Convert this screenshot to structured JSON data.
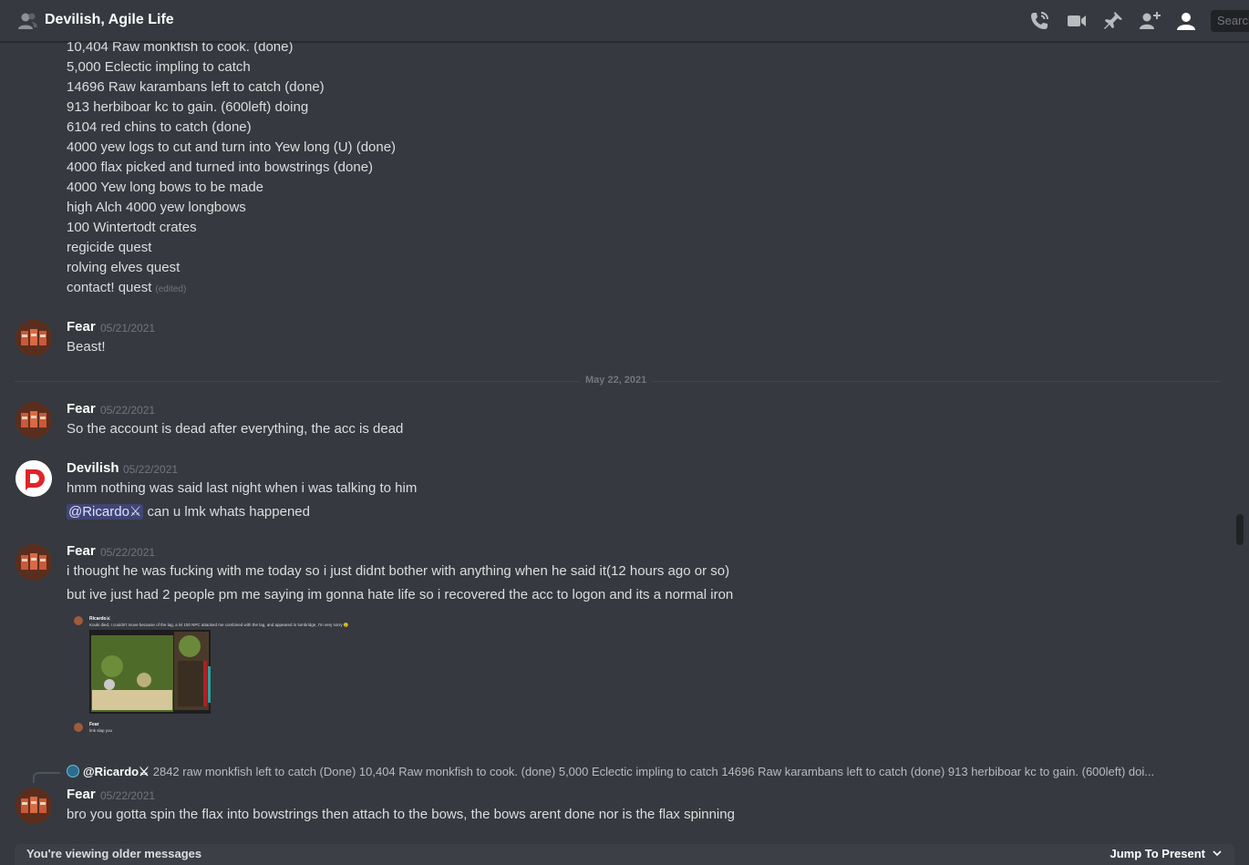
{
  "header": {
    "title": "Devilish, Agile Life",
    "search_placeholder": "Search"
  },
  "continued_lines": [
    "10,404 Raw monkfish to cook.  (done)",
    "5,000 Eclectic impling to catch",
    "14696 Raw karambans left to catch (done)",
    "913 herbiboar kc to gain.   (600left) doing",
    "6104 red chins to catch (done)",
    "4000 yew logs to cut and turn into Yew long (U) (done)",
    "4000 flax picked and turned into bowstrings (done)",
    "4000 Yew long bows to be made",
    "high Alch 4000 yew longbows",
    "100 Wintertodt crates",
    "regicide quest",
    "rolving elves quest",
    "contact! quest"
  ],
  "edited_label": "(edited)",
  "messages": [
    {
      "author": "Fear",
      "timestamp": "05/21/2021",
      "lines": [
        "Beast!"
      ]
    },
    {
      "author": "Fear",
      "timestamp": "05/22/2021",
      "lines": [
        "So the account is dead after everything, the acc is dead"
      ]
    },
    {
      "author": "Devilish",
      "timestamp": "05/22/2021",
      "lines": [
        "hmm nothing was said last night when i was talking to him"
      ],
      "mention": "@Ricardo⚔",
      "mention_rest": " can u lmk whats happened"
    },
    {
      "author": "Fear",
      "timestamp": "05/22/2021",
      "lines": [
        "i thought he was fucking with me today so i just didnt bother with anything when he said it(12 hours ago or so)",
        "but ive just had 2 people pm me saying im gonna hate life so i recovered the acc to logon and its a normal iron"
      ]
    },
    {
      "author": "Fear",
      "timestamp": "05/22/2021",
      "lines": [
        "bro you gotta spin the flax into bowstrings then attach to the bows, the bows arent done nor is the flax spinning"
      ]
    }
  ],
  "date_divider": "May 22, 2021",
  "reply": {
    "name": "@Ricardo⚔",
    "text": "2842 raw monkfish left to catch (Done) 10,404 Raw monkfish to cook.  (done)  5,000 Eclectic impling to catch 14696 Raw karambans left to catch (done)  913 herbiboar kc to gain.   (600left) doi..."
  },
  "attachment": {
    "inner_author_1": "Ricardo⚔",
    "inner_text_1": "Kouki died, I couldn't move because of the lag, a lvl 100 NPC attacked me combined with the lag, and appeared in lumbridge, I'm very sorry 😢",
    "inner_author_2": "Fear",
    "inner_text_2": "lmk slap you"
  },
  "footer": {
    "older_text": "You're viewing older messages",
    "jump_label": "Jump To Present"
  },
  "colors": {
    "background": "#36393f",
    "header_text": "#ffffff",
    "muted": "#72767d",
    "mention_bg": "#414675"
  }
}
